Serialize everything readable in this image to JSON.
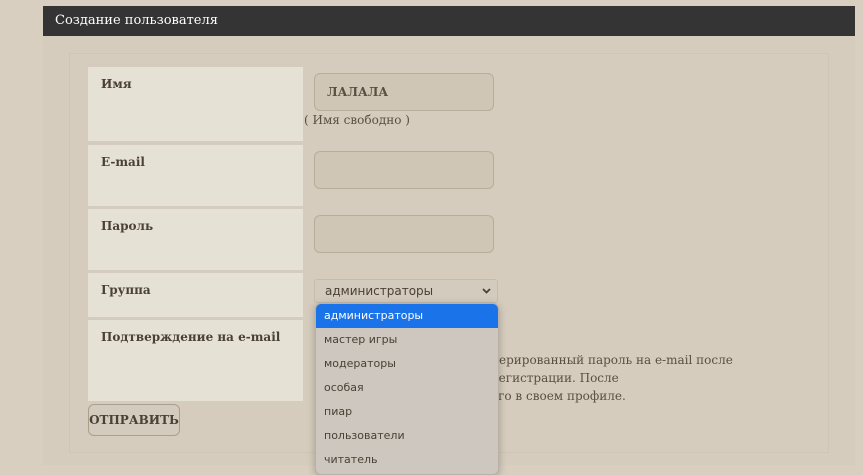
{
  "header": {
    "title": "Создание пользователя"
  },
  "form": {
    "name_label": "Имя",
    "name_value": "ЛАЛАЛА",
    "name_hint": "( Имя свободно )",
    "email_label": "E-mail",
    "email_value": "",
    "password_label": "Пароль",
    "password_value": "",
    "group_label": "Группа",
    "group_selected": "администраторы",
    "group_options": [
      "администраторы",
      "мастер игры",
      "модераторы",
      "особая",
      "пиар",
      "пользователи",
      "читатель"
    ],
    "confirm_label": "Подтверждение на e-mail",
    "confirm_text_line1": "нерированный пароль на e-mail после регистрации. После",
    "confirm_text_line2": "его в своем профиле.",
    "submit_label": "ОТПРАВИТЬ"
  },
  "colors": {
    "header_bg": "#343434",
    "selected_option": "#1a73e8"
  }
}
